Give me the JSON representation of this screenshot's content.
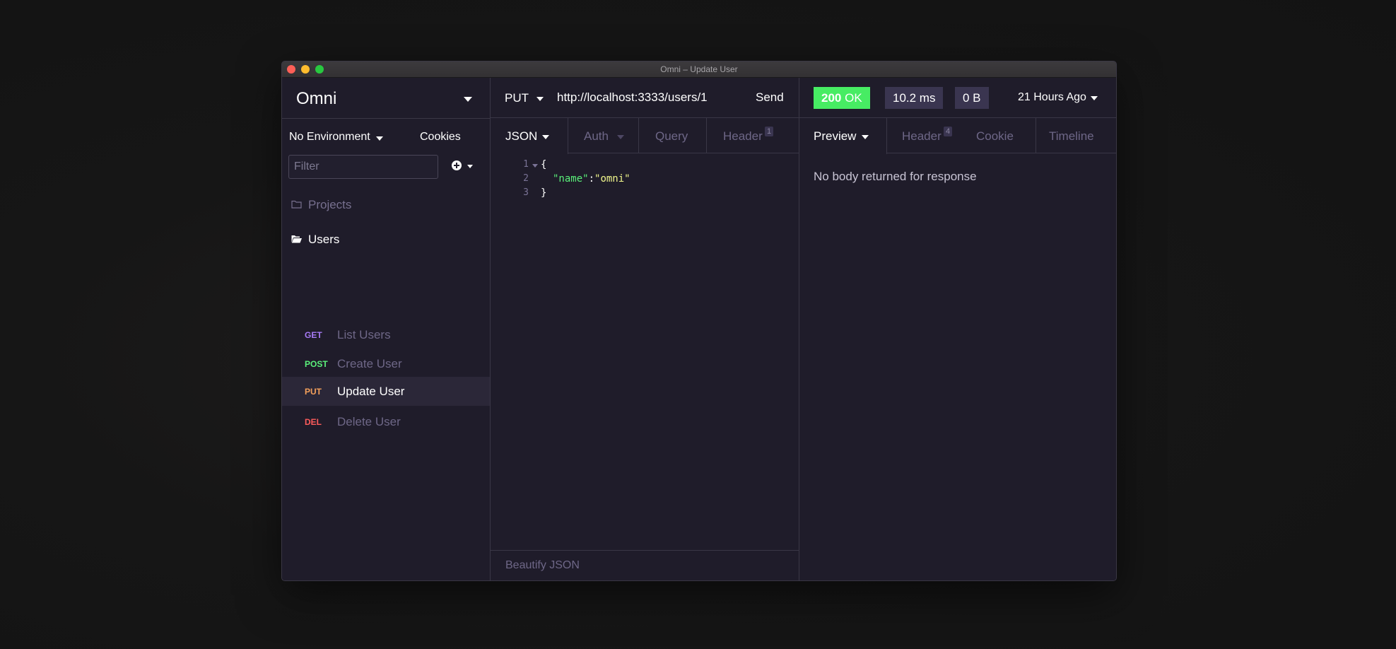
{
  "window": {
    "title": "Omni – Update User"
  },
  "sidebar": {
    "workspace_title": "Omni",
    "environment": "No Environment",
    "cookies_label": "Cookies",
    "filter_placeholder": "Filter",
    "folders": [
      {
        "label": "Projects",
        "icon": "folder-closed-icon"
      },
      {
        "label": "Users",
        "icon": "folder-open-icon"
      }
    ],
    "requests": [
      {
        "method": "GET",
        "label": "List Users",
        "active": false
      },
      {
        "method": "POST",
        "label": "Create User",
        "active": false
      },
      {
        "method": "PUT",
        "label": "Update User",
        "active": true
      },
      {
        "method": "DEL",
        "label": "Delete User",
        "active": false
      }
    ]
  },
  "request": {
    "method": "PUT",
    "url": "http://localhost:3333/users/1",
    "send_label": "Send",
    "tabs": [
      {
        "label": "JSON",
        "active": true
      },
      {
        "label": "Auth",
        "active": false
      },
      {
        "label": "Query",
        "active": false
      },
      {
        "label": "Header",
        "badge": "1",
        "active": false
      }
    ],
    "body_lines": [
      {
        "num": "1",
        "text": "{"
      },
      {
        "num": "2",
        "key": "\"name\"",
        "sep": ":",
        "value": "\"omni\""
      },
      {
        "num": "3",
        "text": "}"
      }
    ],
    "beautify_label": "Beautify JSON"
  },
  "response": {
    "status_code": "200",
    "status_text": "OK",
    "time": "10.2 ms",
    "size": "0 B",
    "when": "21 Hours Ago",
    "tabs": [
      {
        "label": "Preview",
        "active": true
      },
      {
        "label": "Header",
        "badge": "4",
        "active": false
      },
      {
        "label": "Cookie",
        "active": false
      },
      {
        "label": "Timeline",
        "active": false
      }
    ],
    "empty_message": "No body returned for response"
  },
  "colors": {
    "get": "#a77bf6",
    "post": "#5af07a",
    "put": "#f5a05b",
    "del": "#fd5b5b",
    "status_ok": "#47ec63",
    "json_key": "#5af07a",
    "json_value": "#f1f78c"
  }
}
